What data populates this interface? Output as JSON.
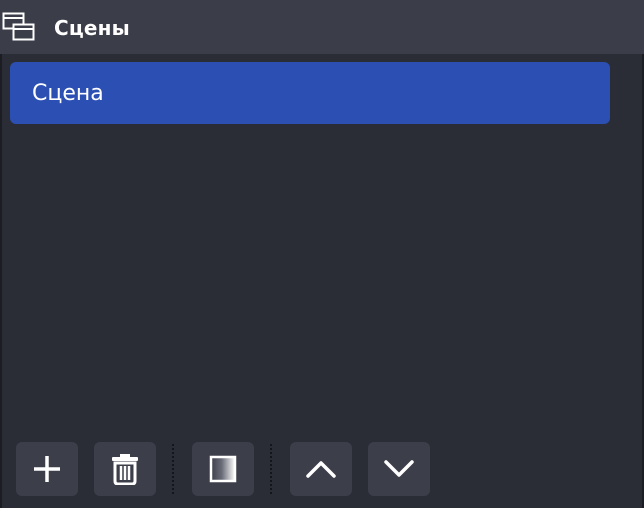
{
  "dock": {
    "title": "Сцены",
    "title_icon": "scenes-icon"
  },
  "scenes": [
    {
      "label": "Сцена",
      "selected": true
    }
  ],
  "toolbar": {
    "buttons": [
      {
        "icon": "plus-icon"
      },
      {
        "icon": "trash-icon"
      },
      {
        "icon": "filters-icon"
      },
      {
        "icon": "chevron-up-icon"
      },
      {
        "icon": "chevron-down-icon"
      }
    ]
  },
  "colors": {
    "background": "#2b2d36",
    "titlebar": "#3b3d48",
    "selection": "#2c4fb3",
    "button": "#3c3e4a"
  }
}
